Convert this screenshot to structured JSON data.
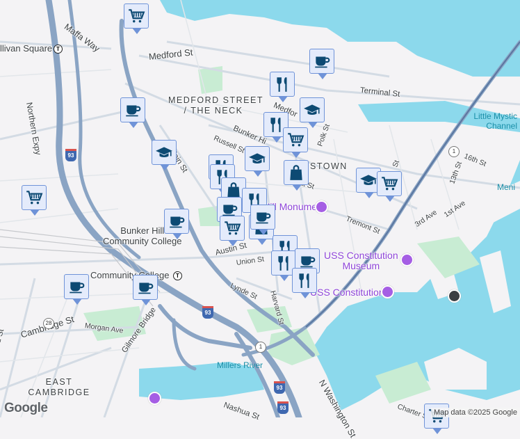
{
  "labels": {
    "medford_st": "Medford St",
    "maffa_way": "Maffa Way",
    "sullivan_square": "llivan Square",
    "northern_expy": "Northern Expy",
    "neighborhood": "MEDFORD STREET",
    "neighborhood_2": "/ THE NECK",
    "main_st": "Main St",
    "russell_st": "Russell St",
    "bunker_hill_st": "Bunker Hi",
    "medford_st_2": "Medfor",
    "terminal_st": "Terminal St",
    "little_mystic": "Little Mystic",
    "channel": "Channel",
    "sixteenth_st": "16th St",
    "thirteenth_st": "13th St",
    "meni": "Meni",
    "charlestown": "STOWN",
    "polk_st": "Polk St",
    "bartlett_st": "artlett St",
    "tremont_st": "Tremont St",
    "third_ave": "3rd Ave",
    "first_ave": "1st Ave",
    "monument": "Bunker Hill Monument",
    "college": "Bunker Hill",
    "college_2": "Community College",
    "austin_st": "Austin St",
    "union_st": "Union St",
    "lynde_st": "Lynde St",
    "harvard_st": "Harvard St",
    "uss_museum": "USS Constitution",
    "uss_museum_2": "Museum",
    "uss_constitution": "USS Constitution",
    "cc_station": "Community College",
    "morgan_ave": "Morgan Ave",
    "cambridge_st": "Cambridge St",
    "gilmore_bridge": "Gilmore Bridge",
    "third_st": "Third St",
    "millers_river": "Millers River",
    "east_cambridge": "EAST",
    "east_cambridge_2": "CAMBRIDGE",
    "nashua_st": "Nashua St",
    "n_washington_st": "N Washington St",
    "charter_st": "Charter St",
    "st_label": "St"
  },
  "shields": {
    "i93": "93",
    "us1": "1",
    "rt28": "28"
  },
  "attribution": "Map data ©2025 Google",
  "logo": "Google",
  "colors": {
    "water": "#8cd9ec",
    "land": "#f4f3f5",
    "park": "#c8ecd3",
    "highway": "#8aa4c4",
    "marker_bg": "#e4ebfb",
    "marker_border": "#6f93d8",
    "icon": "#0d4a73",
    "poi": "#a55ee4"
  },
  "markers": [
    "shopping-cart",
    "coffee",
    "restaurant",
    "coffee",
    "graduation-cap",
    "restaurant",
    "graduation-cap",
    "shopping-cart",
    "graduation-cap",
    "restaurant",
    "shopping-bag",
    "shopping-cart",
    "graduation-cap",
    "shopping-cart",
    "restaurant",
    "shopping-bag",
    "restaurant",
    "coffee",
    "coffee",
    "shopping-cart",
    "shopping-bag",
    "coffee",
    "restaurant",
    "restaurant",
    "coffee",
    "restaurant",
    "coffee",
    "coffee",
    "shopping-cart"
  ]
}
